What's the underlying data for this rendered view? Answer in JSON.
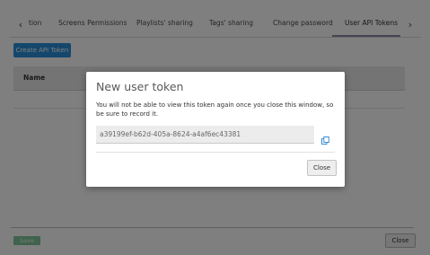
{
  "tabs": {
    "left_arrow": "‹",
    "right_arrow": "›",
    "items": [
      {
        "label": "tion"
      },
      {
        "label": "Screens Permissions"
      },
      {
        "label": "Playlists' sharing"
      },
      {
        "label": "Tags' sharing"
      },
      {
        "label": "Change password"
      },
      {
        "label": "User API Tokens"
      }
    ],
    "active_index": 5
  },
  "toolbar": {
    "create_label": "Create API Token"
  },
  "table": {
    "columns": [
      "Name"
    ]
  },
  "footer": {
    "save_label": "Save",
    "close_label": "Close"
  },
  "modal": {
    "title": "New user token",
    "message": "You will not be able to view this token again once you close this window, so be sure to record it.",
    "token_value": "a39199ef-b62d-405a-8624-a4af6ec43381",
    "copy_icon": "copy-icon",
    "close_label": "Close"
  },
  "colors": {
    "accent": "#2a8fd8",
    "save_button": "#7fc79a",
    "overlay": "#000000"
  }
}
